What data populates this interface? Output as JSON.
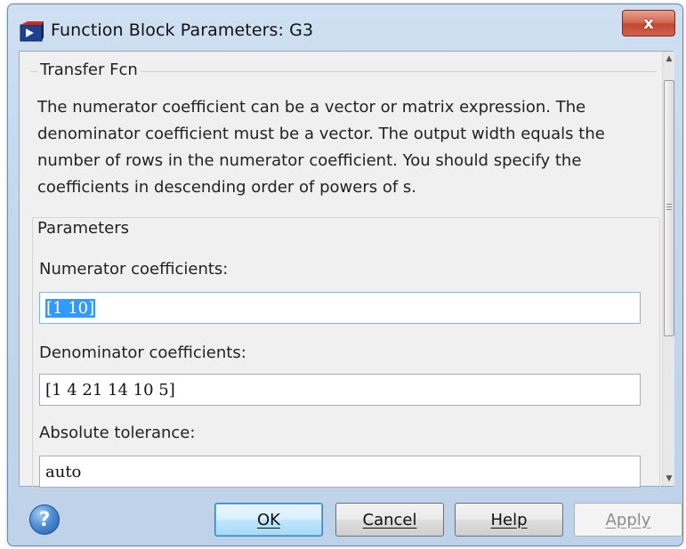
{
  "window": {
    "title": "Function Block Parameters: G3",
    "close_glyph": "x"
  },
  "block": {
    "name": "Transfer Fcn",
    "description": "The numerator coefficient can be a vector or matrix expression. The denominator coefficient must be a vector. The output width equals the number of rows in the numerator coefficient. You should specify the coefficients in descending order of powers of s."
  },
  "parameters": {
    "title": "Parameters",
    "numerator": {
      "label": "Numerator coefficients:",
      "value": "[1 10]"
    },
    "denominator": {
      "label": "Denominator coefficients:",
      "value": "[1 4 21 14 10 5]"
    },
    "tolerance": {
      "label": "Absolute tolerance:",
      "value": "auto"
    }
  },
  "buttons": {
    "help_glyph": "?",
    "ok": "OK",
    "cancel": "Cancel",
    "help": "Help",
    "apply": "Apply"
  },
  "icons": {
    "app": "simulink-block-icon",
    "help": "question-icon",
    "close": "close-icon"
  }
}
